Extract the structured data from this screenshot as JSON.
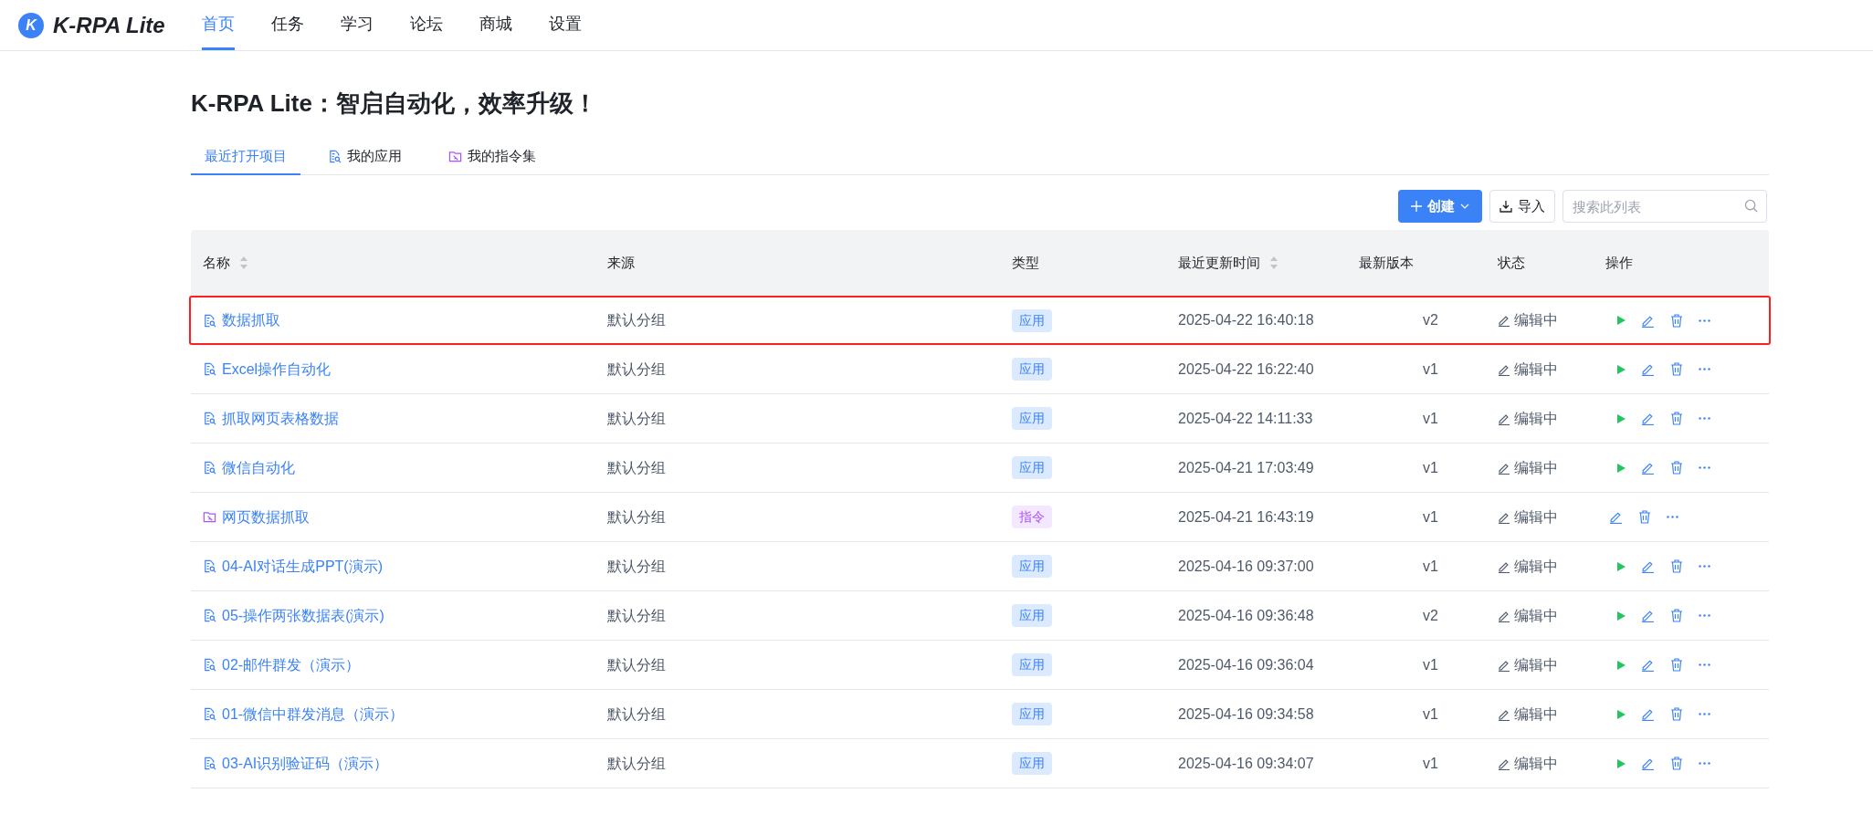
{
  "app": {
    "logo_letter": "K",
    "name": "K-RPA Lite"
  },
  "nav": [
    {
      "label": "首页",
      "selected": true
    },
    {
      "label": "任务",
      "selected": false
    },
    {
      "label": "学习",
      "selected": false
    },
    {
      "label": "论坛",
      "selected": false
    },
    {
      "label": "商城",
      "selected": false
    },
    {
      "label": "设置",
      "selected": false
    }
  ],
  "headline": "K-RPA Lite：智启自动化，效率升级！",
  "tabs": [
    {
      "label": "最近打开项目",
      "kind": "plain",
      "selected": true
    },
    {
      "label": "我的应用",
      "kind": "app",
      "selected": false
    },
    {
      "label": "我的指令集",
      "kind": "command",
      "selected": false
    }
  ],
  "toolbar": {
    "create": "创建",
    "import": "导入",
    "search": {
      "placeholder": "搜索此列表"
    }
  },
  "table": {
    "columns": [
      {
        "label": "名称",
        "sortable": true
      },
      {
        "label": "来源",
        "sortable": false
      },
      {
        "label": "类型",
        "sortable": false
      },
      {
        "label": "最近更新时间",
        "sortable": true
      },
      {
        "label": "最新版本",
        "sortable": false
      },
      {
        "label": "状态",
        "sortable": false
      },
      {
        "label": "操作",
        "sortable": false
      }
    ],
    "rows": [
      {
        "name": "数据抓取",
        "source": "默认分组",
        "kind": "app",
        "type": "应用",
        "updated": "2025-04-22 16:40:18",
        "version": "v2",
        "status": "编辑中",
        "highlighted": true
      },
      {
        "name": "Excel操作自动化",
        "source": "默认分组",
        "kind": "app",
        "type": "应用",
        "updated": "2025-04-22 16:22:40",
        "version": "v1",
        "status": "编辑中",
        "highlighted": false
      },
      {
        "name": "抓取网页表格数据",
        "source": "默认分组",
        "kind": "app",
        "type": "应用",
        "updated": "2025-04-22 14:11:33",
        "version": "v1",
        "status": "编辑中",
        "highlighted": false
      },
      {
        "name": "微信自动化",
        "source": "默认分组",
        "kind": "app",
        "type": "应用",
        "updated": "2025-04-21 17:03:49",
        "version": "v1",
        "status": "编辑中",
        "highlighted": false
      },
      {
        "name": "网页数据抓取",
        "source": "默认分组",
        "kind": "command",
        "type": "指令",
        "updated": "2025-04-21 16:43:19",
        "version": "v1",
        "status": "编辑中",
        "highlighted": false
      },
      {
        "name": "04-AI对话生成PPT(演示)",
        "source": "默认分组",
        "kind": "app",
        "type": "应用",
        "updated": "2025-04-16 09:37:00",
        "version": "v1",
        "status": "编辑中",
        "highlighted": false
      },
      {
        "name": "05-操作两张数据表(演示)",
        "source": "默认分组",
        "kind": "app",
        "type": "应用",
        "updated": "2025-04-16 09:36:48",
        "version": "v2",
        "status": "编辑中",
        "highlighted": false
      },
      {
        "name": "02-邮件群发（演示）",
        "source": "默认分组",
        "kind": "app",
        "type": "应用",
        "updated": "2025-04-16 09:36:04",
        "version": "v1",
        "status": "编辑中",
        "highlighted": false
      },
      {
        "name": "01-微信中群发消息（演示）",
        "source": "默认分组",
        "kind": "app",
        "type": "应用",
        "updated": "2025-04-16 09:34:58",
        "version": "v1",
        "status": "编辑中",
        "highlighted": false
      },
      {
        "name": "03-AI识别验证码（演示）",
        "source": "默认分组",
        "kind": "app",
        "type": "应用",
        "updated": "2025-04-16 09:34:07",
        "version": "v1",
        "status": "编辑中",
        "highlighted": false
      }
    ]
  }
}
